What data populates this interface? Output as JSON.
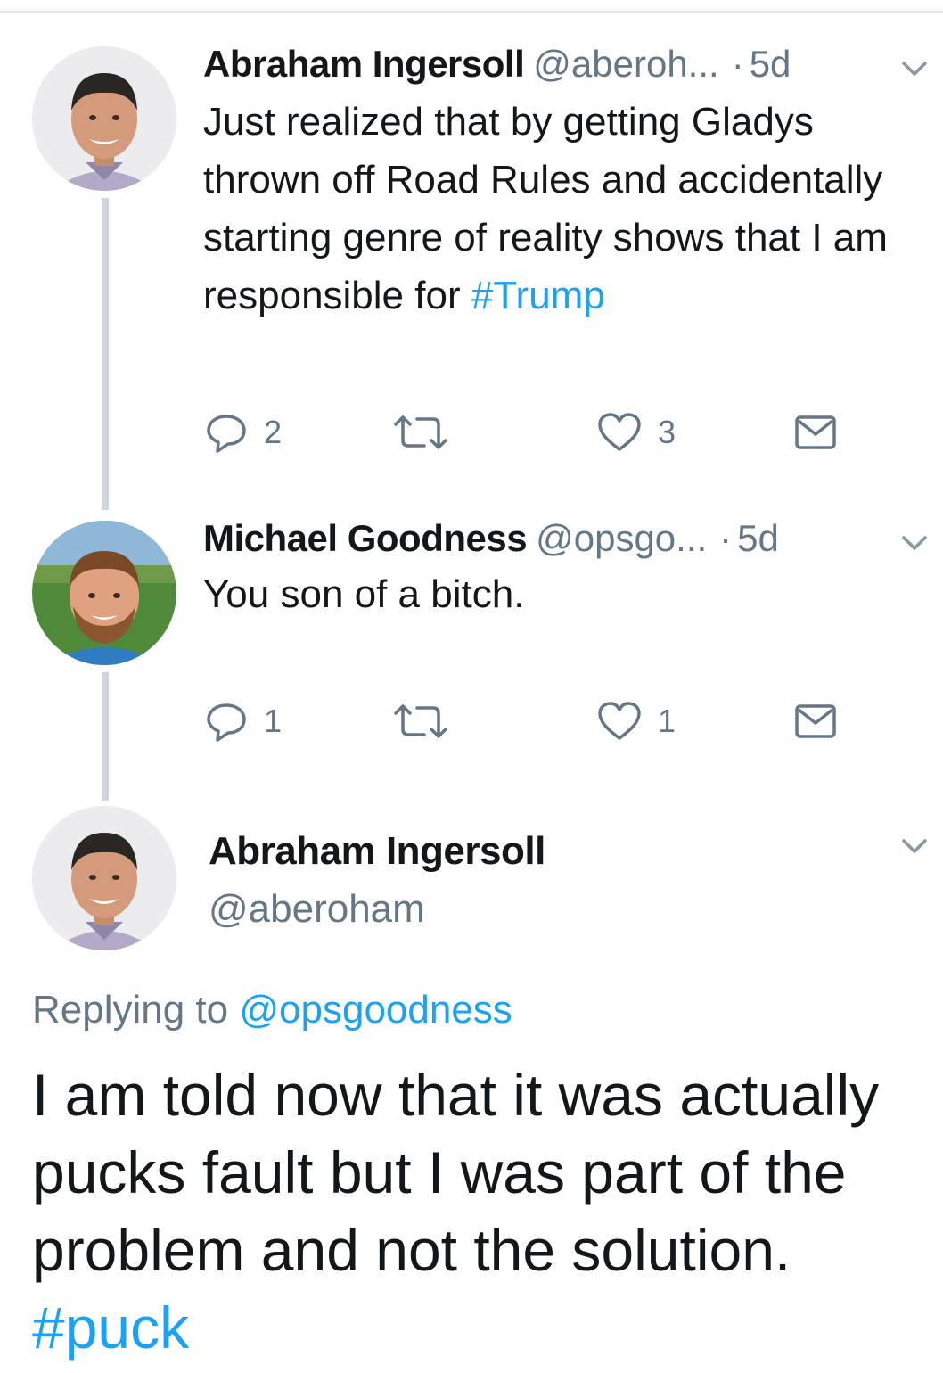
{
  "tweets": [
    {
      "author_name": "Abraham Ingersoll",
      "author_handle": "@aberoh...",
      "separator": "·",
      "time": "5d",
      "text": "Just realized that by getting Gladys thrown off Road Rules and accidentally starting genre of reality shows that I am responsible for ",
      "hashtag": "#Trump",
      "reply_count": "2",
      "retweet_count": "",
      "like_count": "3"
    },
    {
      "author_name": "Michael Goodness",
      "author_handle": "@opsgo...",
      "separator": "·",
      "time": "5d",
      "text": "You son of a bitch.",
      "reply_count": "1",
      "retweet_count": "",
      "like_count": "1"
    }
  ],
  "main_tweet": {
    "author_name": "Abraham Ingersoll",
    "author_handle": "@aberoham",
    "replying_prefix": "Replying to ",
    "replying_to": "@opsgoodness",
    "text": "I am told now that it was actually pucks fault but I was part of the problem and not the solution. ",
    "hashtag": "#puck"
  },
  "icons": {
    "reply": "reply-icon",
    "retweet": "retweet-icon",
    "like": "like-icon",
    "message": "direct-message-icon",
    "menu": "chevron-down-icon"
  },
  "colors": {
    "link": "#1da1f2",
    "secondary": "#657786",
    "text": "#14171a",
    "thread_line": "#ccd6dd"
  }
}
